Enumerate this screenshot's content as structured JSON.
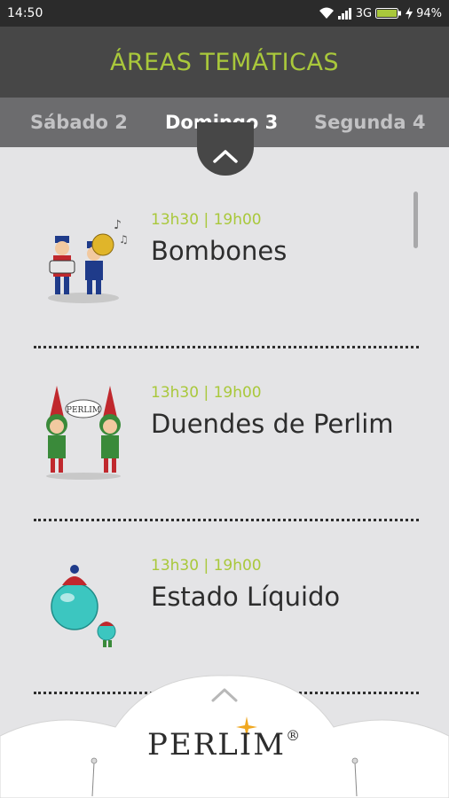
{
  "status": {
    "time": "14:50",
    "network": "3G",
    "battery": "94%"
  },
  "header": {
    "title": "ÁREAS TEMÁTICAS"
  },
  "tabs": [
    {
      "label": "Sábado 2",
      "selected": false
    },
    {
      "label": "Domingo 3",
      "selected": true
    },
    {
      "label": "Segunda 4",
      "selected": false
    }
  ],
  "events": [
    {
      "time": "13h30 | 19h00",
      "title": "Bombones",
      "icon": "marching-band-icon"
    },
    {
      "time": "13h30 | 19h00",
      "title": "Duendes de Perlim",
      "icon": "elves-icon"
    },
    {
      "time": "13h30 | 19h00",
      "title": "Estado Líquido",
      "icon": "bubble-character-icon"
    }
  ],
  "footer": {
    "logo_text": "PERLIM",
    "registered_mark": "®"
  },
  "colors": {
    "accent": "#a9c83b",
    "app_bar": "#474747",
    "tab_bar": "#6c6c6e",
    "background": "#e4e4e6"
  }
}
